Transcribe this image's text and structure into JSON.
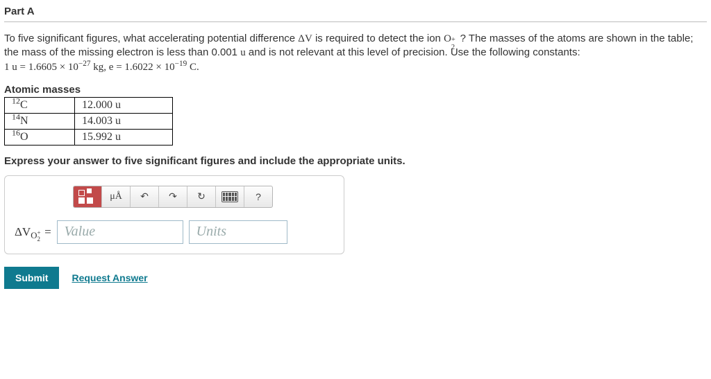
{
  "part_header": "Part A",
  "question": {
    "pre1": "To five significant figures, what accelerating potential difference ",
    "dv": "ΔV",
    "pre2": " is required to detect the ion ",
    "ion_base": "O",
    "ion_sup": "+",
    "ion_sub": "2",
    "pre3": " ? The masses of the atoms are shown in the table; the mass of the missing electron is less than 0.001 ",
    "u1": "u",
    "pre4": " and is not relevant at this level of precision. Use the following constants: ",
    "const_line": "1 u = 1.6605 × 10",
    "const_exp1": "−27",
    "const_mid": " kg, e = 1.6022 × 10",
    "const_exp2": "−19",
    "const_end": " C."
  },
  "table_title": "Atomic masses",
  "masses": [
    {
      "sup": "12",
      "el": "C",
      "val": "12.000 u"
    },
    {
      "sup": "14",
      "el": "N",
      "val": "14.003 u"
    },
    {
      "sup": "16",
      "el": "O",
      "val": "15.992 u"
    }
  ],
  "instruction": "Express your answer to five significant figures and include the appropriate units.",
  "toolbar": {
    "units_btn": "μÅ",
    "help": "?"
  },
  "answer": {
    "var_pre": "ΔV",
    "var_base": "O",
    "var_sup": "+",
    "var_sub": "2",
    "equals": " =",
    "value_placeholder": "Value",
    "units_placeholder": "Units"
  },
  "submit_label": "Submit",
  "request_label": "Request Answer"
}
